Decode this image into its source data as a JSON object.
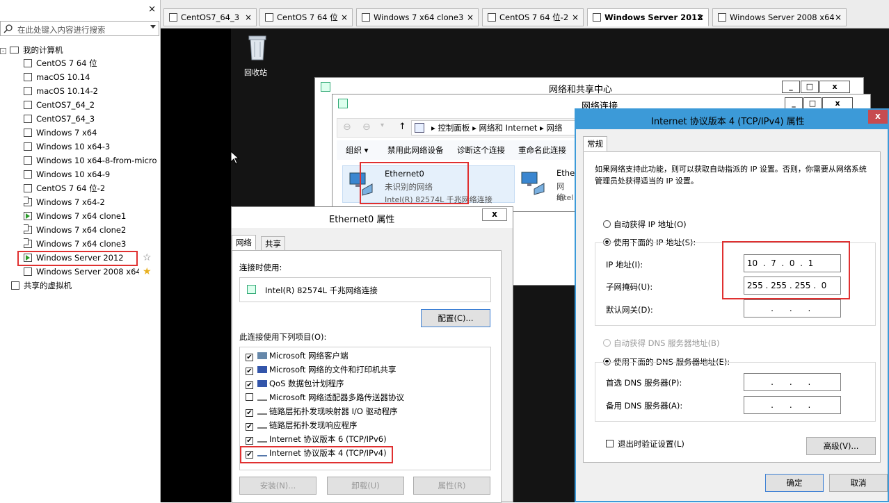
{
  "sidebar": {
    "search_placeholder": "在此处键入内容进行搜索",
    "close": "×",
    "root": "我的计算机",
    "items": [
      {
        "label": "CentOS 7 64 位"
      },
      {
        "label": "macOS 10.14"
      },
      {
        "label": "macOS 10.14-2"
      },
      {
        "label": "CentOS7_64_2"
      },
      {
        "label": "CentOS7_64_3"
      },
      {
        "label": "Windows 7 x64"
      },
      {
        "label": "Windows 10 x64-3"
      },
      {
        "label": "Windows 10 x64-8-from-micro"
      },
      {
        "label": "Windows 10 x64-9"
      },
      {
        "label": "CentOS 7 64 位-2"
      },
      {
        "label": "Windows 7 x64-2"
      },
      {
        "label": "Windows 7 x64 clone1"
      },
      {
        "label": "Windows 7 x64 clone2"
      },
      {
        "label": "Windows 7 x64 clone3"
      },
      {
        "label": "Windows Server 2012"
      },
      {
        "label": "Windows Server 2008 x64"
      }
    ],
    "shared": "共享的虚拟机"
  },
  "tabs": [
    {
      "label": "CentOS7_64_3"
    },
    {
      "label": "CentOS 7 64 位"
    },
    {
      "label": "Windows 7 x64 clone3"
    },
    {
      "label": "CentOS 7 64 位-2"
    },
    {
      "label": "Windows Server 2012"
    },
    {
      "label": "Windows Server 2008 x64"
    }
  ],
  "desktop": {
    "recycle_bin": "回收站"
  },
  "nsc": {
    "title": "网络和共享中心"
  },
  "netconn": {
    "title": "网络连接",
    "breadcrumb": [
      "控制面板",
      "网络和 Internet",
      "网络"
    ],
    "toolbar": [
      "组织 ▾",
      "禁用此网络设备",
      "诊断这个连接",
      "重命名此连接"
    ],
    "adapter1": {
      "name": "Ethernet0",
      "status": "未识别的网络",
      "device": "Intel(R) 82574L 千兆网络连接"
    },
    "adapter2": {
      "name": "Ethe",
      "status": "网络",
      "device": "Intel"
    }
  },
  "eth": {
    "title": "Ethernet0 属性",
    "tabs": [
      "网络",
      "共享"
    ],
    "connect_using": "连接时使用:",
    "adapter": "Intel(R) 82574L 千兆网络连接",
    "configure": "配置(C)...",
    "items_label": "此连接使用下列项目(O):",
    "items": [
      {
        "label": "Microsoft 网络客户端",
        "checked": "✔"
      },
      {
        "label": "Microsoft 网络的文件和打印机共享",
        "checked": "✔"
      },
      {
        "label": "QoS 数据包计划程序",
        "checked": "✔"
      },
      {
        "label": "Microsoft 网络适配器多路传送器协议",
        "checked": ""
      },
      {
        "label": "链路层拓扑发现映射器 I/O 驱动程序",
        "checked": "✔"
      },
      {
        "label": "链路层拓扑发现响应程序",
        "checked": "✔"
      },
      {
        "label": "Internet 协议版本 6 (TCP/IPv6)",
        "checked": "✔"
      },
      {
        "label": "Internet 协议版本 4 (TCP/IPv4)",
        "checked": "✔"
      }
    ],
    "install": "安装(N)...",
    "uninstall": "卸载(U)",
    "properties": "属性(R)"
  },
  "ipv4": {
    "title": "Internet 协议版本 4 (TCP/IPv4) 属性",
    "tab": "常规",
    "desc": "如果网络支持此功能，则可以获取自动指派的 IP 设置。否则，你需要从网络系统管理员处获得适当的 IP 设置。",
    "auto_ip": "自动获得 IP 地址(O)",
    "manual_ip": "使用下面的 IP 地址(S):",
    "ip_label": "IP 地址(I):",
    "ip_value": " 10  .  7  .  0  .  1",
    "mask_label": "子网掩码(U):",
    "mask_value": " 255 . 255 . 255 .  0",
    "gw_label": "默认网关(D):",
    "empty_ip": "          .      .      .",
    "auto_dns": "自动获得 DNS 服务器地址(B)",
    "manual_dns": "使用下面的 DNS 服务器地址(E):",
    "dns1_label": "首选 DNS 服务器(P):",
    "dns2_label": "备用 DNS 服务器(A):",
    "validate": "退出时验证设置(L)",
    "advanced": "高级(V)...",
    "ok": "确定",
    "cancel": "取消",
    "close": "x"
  },
  "colors": {
    "highlight": "#e03030",
    "accent": "#3c9ad8"
  }
}
